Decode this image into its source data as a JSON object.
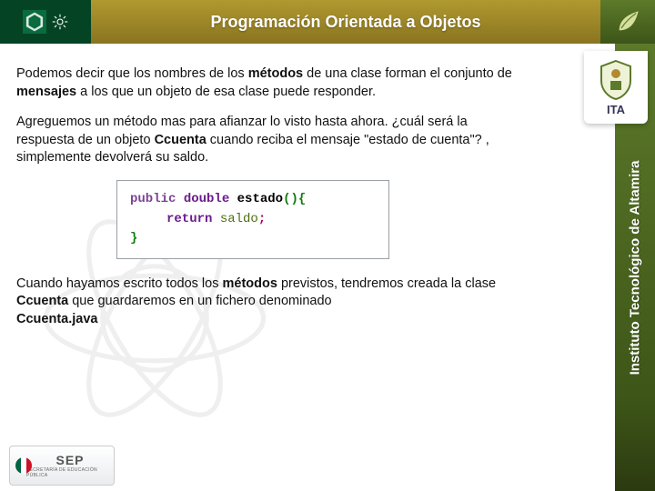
{
  "header": {
    "title": "Programación Orientada a Objetos"
  },
  "right_strip": "Instituto Tecnológico de Altamira",
  "badge": "ITA",
  "paragraphs": {
    "p1a": "Podemos decir que los nombres de los ",
    "p1b": "métodos",
    "p1c": " de una clase forman el conjunto de ",
    "p1d": "mensajes",
    "p1e": " a los que un objeto de esa clase puede responder.",
    "p2a": "Agreguemos un método mas para afianzar lo visto hasta ahora. ¿cuál será la respuesta de un objeto ",
    "p2b": "Ccuenta",
    "p2c": " cuando reciba el mensaje \"estado de cuenta\"? , simplemente devolverá su saldo.",
    "p3a": "Cuando hayamos escrito todos los ",
    "p3b": "métodos",
    "p3c": " previstos, tendremos creada la clase ",
    "p3d": "Ccuenta",
    "p3e": " que guardaremos en un fichero denominado ",
    "p3f": "Ccuenta.java"
  },
  "code": {
    "kw_public": "public",
    "ty_double": "double",
    "fn_name": "estado",
    "parens": "()",
    "brace_open": "{",
    "kw_return": "return",
    "var_saldo": "saldo",
    "semi": ";",
    "brace_close": "}"
  },
  "footer": {
    "sep": "SEP",
    "sep_sub": "SECRETARÍA DE EDUCACIÓN PÚBLICA"
  }
}
